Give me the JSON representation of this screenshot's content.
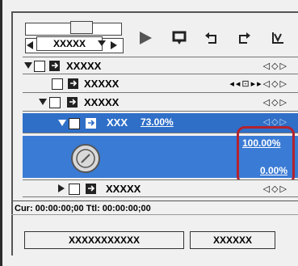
{
  "selector": {
    "value": "XXXXX"
  },
  "rows": [
    {
      "label": "XXXXX",
      "keyframes": "◁◇▷"
    },
    {
      "label": "XXXXX",
      "keyframes": "◂◂⊡▸▸◁◇▷"
    },
    {
      "label": "XXXXX",
      "keyframes": "◁◇▷"
    },
    {
      "label": "XXX",
      "percent": "73.00%",
      "keyframes": "◁◇▷"
    },
    {
      "label": "XXXXX",
      "keyframes": "◁◇▷"
    }
  ],
  "values": {
    "top": "100.00%",
    "bottom": "0.00%"
  },
  "status": {
    "text": "Cur: 00:00:00;00  Ttl: 00:00:00;00"
  },
  "buttons": {
    "left": "XXXXXXXXXXX",
    "right": "XXXXXX"
  },
  "colors": {
    "selection": "#2f6fc8",
    "highlight_box": "#b3232f"
  }
}
